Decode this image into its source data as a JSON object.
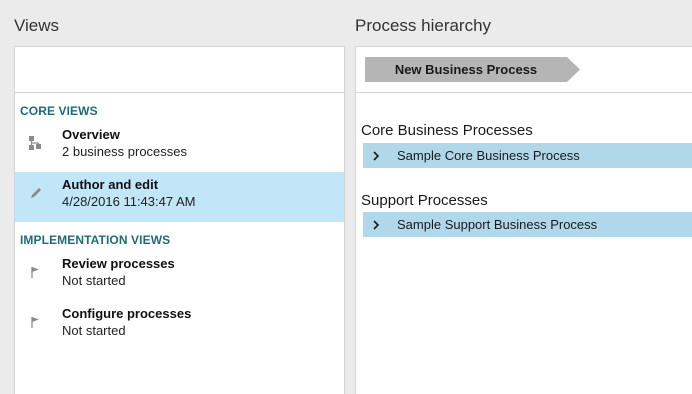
{
  "views_panel": {
    "title": "Views",
    "core_views_header": "CORE VIEWS",
    "implementation_views_header": "IMPLEMENTATION VIEWS",
    "core_items": [
      {
        "title": "Overview",
        "subtitle": "2 business processes",
        "icon": "hierarchy-icon",
        "selected": false
      },
      {
        "title": "Author and edit",
        "subtitle": "4/28/2016 11:43:47 AM",
        "icon": "pencil-icon",
        "selected": true
      }
    ],
    "implementation_items": [
      {
        "title": "Review processes",
        "subtitle": "Not started",
        "icon": "flag-icon"
      },
      {
        "title": "Configure processes",
        "subtitle": "Not started",
        "icon": "flag-icon"
      }
    ]
  },
  "hierarchy_panel": {
    "title": "Process hierarchy",
    "new_button_label": "New Business Process",
    "groups": [
      {
        "label": "Core Business Processes",
        "processes": [
          "Sample Core Business Process"
        ]
      },
      {
        "label": "Support Processes",
        "processes": [
          "Sample Support Business Process"
        ]
      }
    ]
  },
  "colors": {
    "selected_row": "#c1e6f8",
    "process_row": "#b1d8ea",
    "group_header": "#1f6b78",
    "new_button": "#b5b5b5"
  }
}
